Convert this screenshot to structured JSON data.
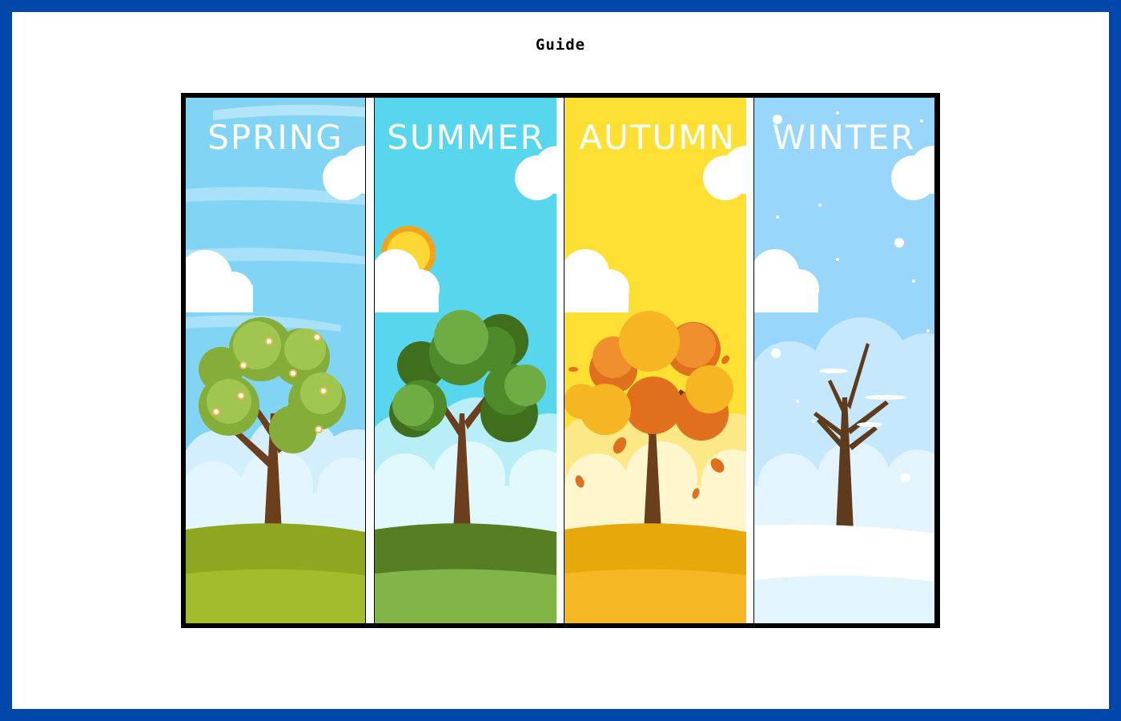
{
  "page": {
    "title": "Guide"
  },
  "illustration": {
    "seasons": [
      {
        "label": "SPRING",
        "sky": "#82d4f5",
        "ground_back": "#8fa620",
        "ground_front": "#a2bc2c"
      },
      {
        "label": "SUMMER",
        "sky": "#58d6ee",
        "ground_back": "#567f24",
        "ground_front": "#81b548"
      },
      {
        "label": "AUTUMN",
        "sky": "#fde033",
        "ground_back": "#e6a80a",
        "ground_front": "#f5b824"
      },
      {
        "label": "WINTER",
        "sky": "#98d7fb",
        "ground_back": "#ffffff",
        "ground_front": "#e2f4fc"
      }
    ],
    "border_color": "#000000",
    "frame_color": "#0047ab"
  }
}
